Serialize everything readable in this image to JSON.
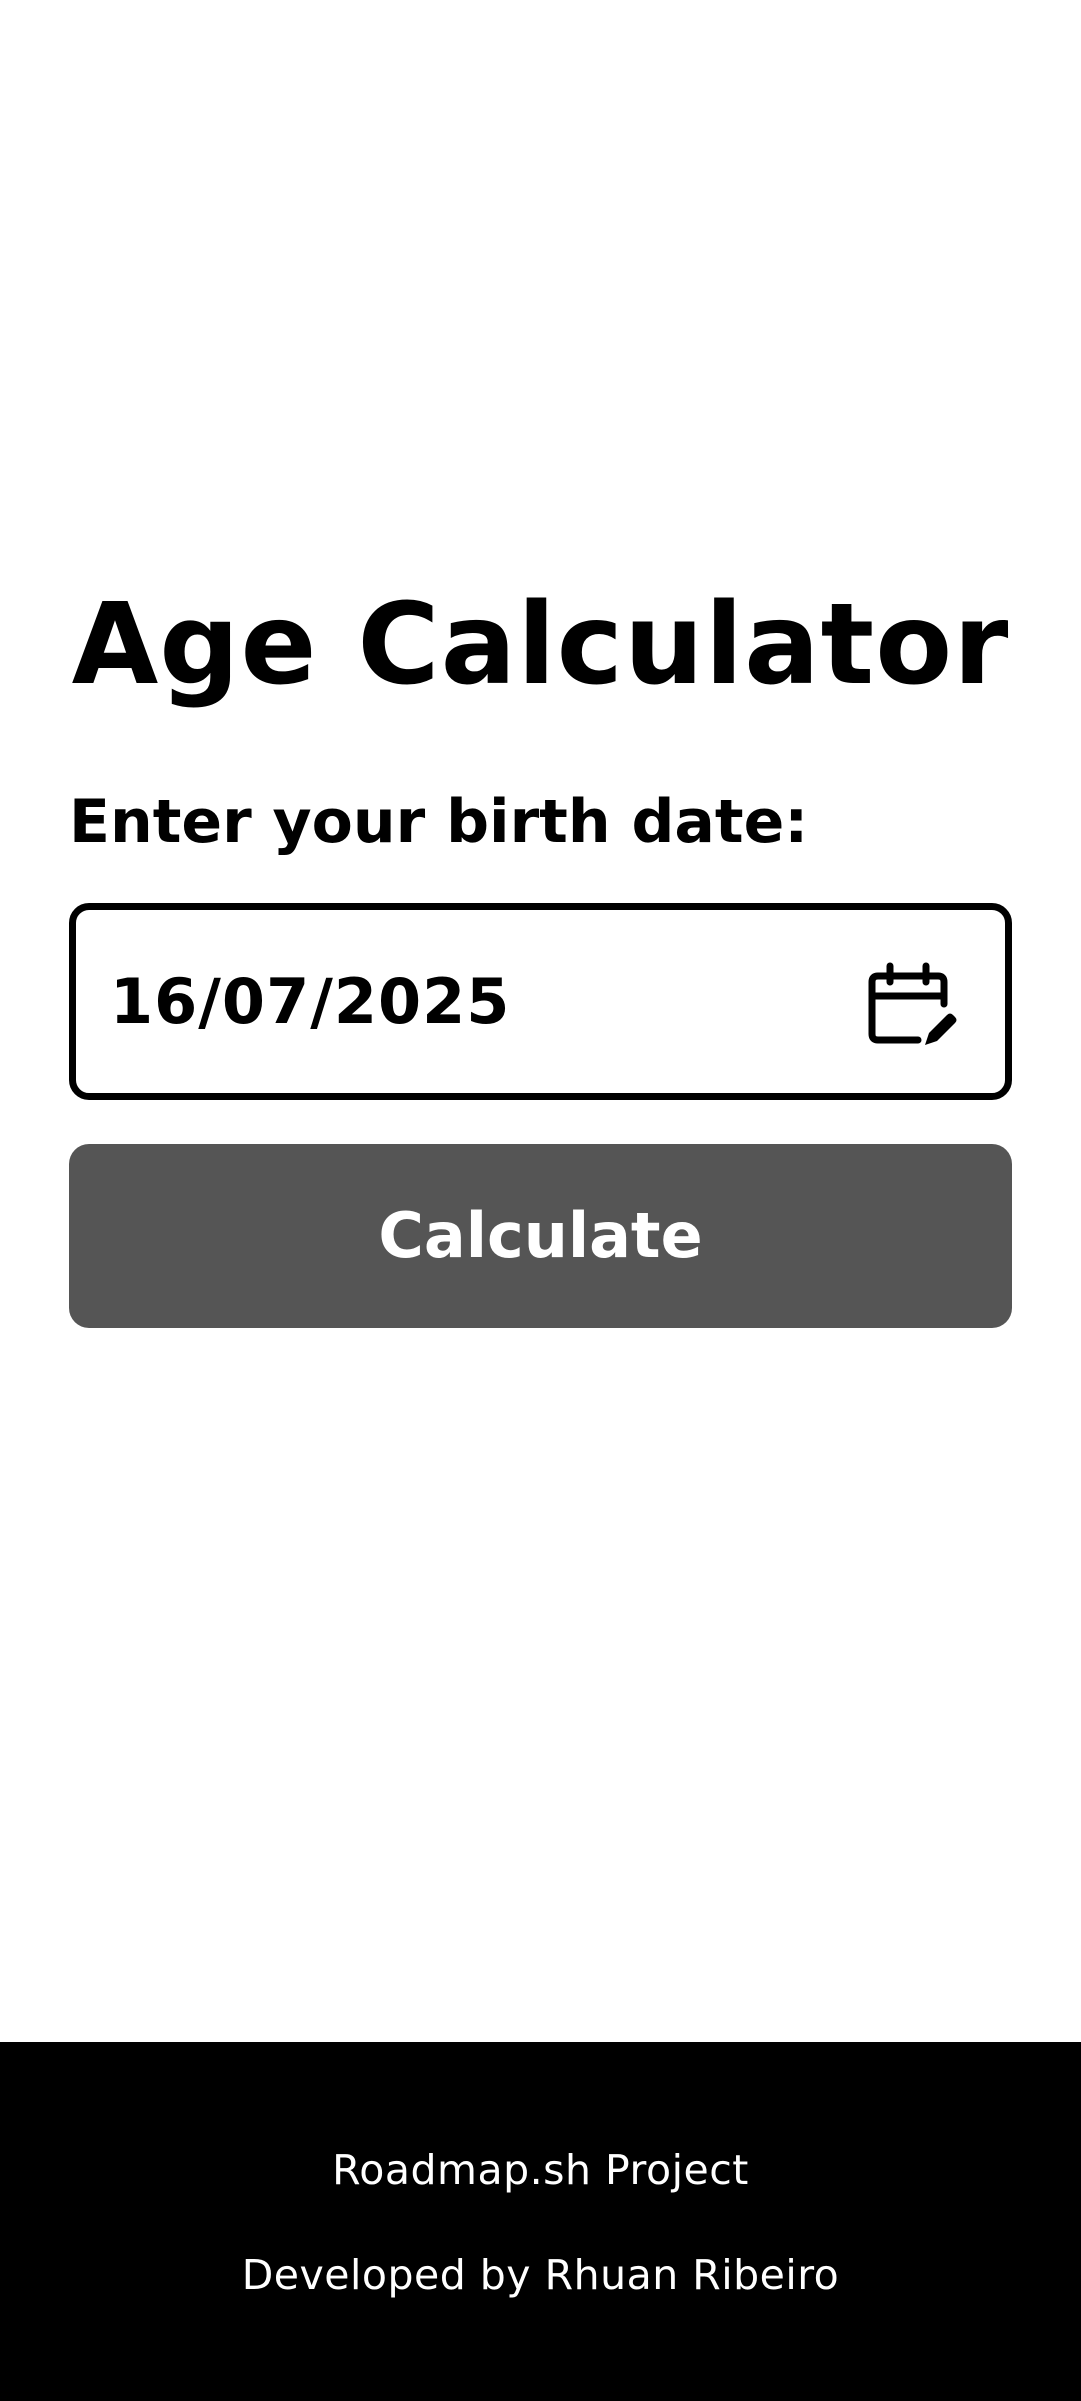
{
  "main": {
    "title": "Age Calculator",
    "birth_date_label": "Enter your birth date:",
    "birth_date_value": "16/07/2025",
    "calendar_icon": "calendar-edit-icon",
    "calculate_label": "Calculate"
  },
  "footer": {
    "project_text": "Roadmap.sh Project",
    "developer_text": "Developed by Rhuan Ribeiro"
  },
  "colors": {
    "background": "#ffffff",
    "text": "#000000",
    "button_background": "#555555",
    "button_text": "#ffffff",
    "footer_background": "#000000",
    "footer_text": "#ffffff"
  }
}
